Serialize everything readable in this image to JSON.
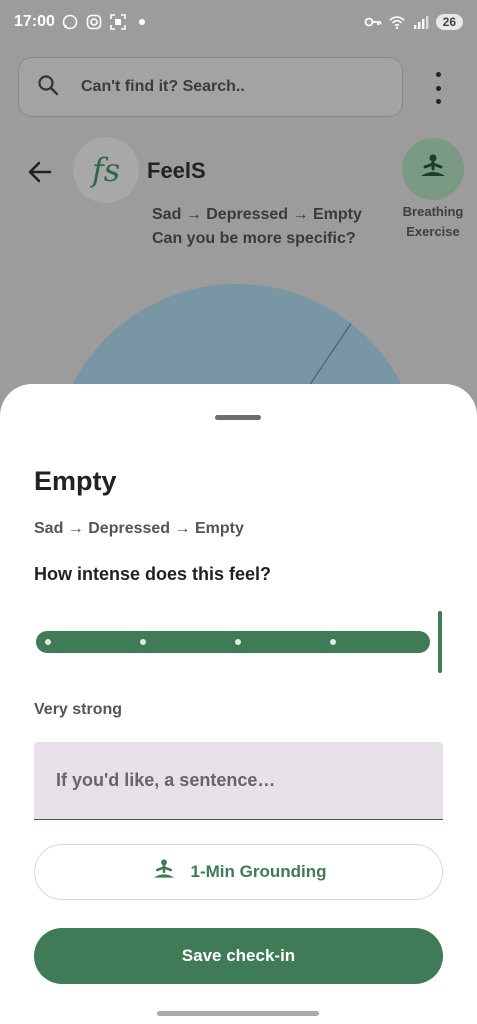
{
  "status_bar": {
    "time": "17:00",
    "battery": "26"
  },
  "search": {
    "placeholder": "Can't find it? Search.."
  },
  "header": {
    "logo_text": "fs",
    "app_title": "FeelS",
    "path": "Sad → Depressed → Empty",
    "prompt": "Can you be more specific?",
    "breathing_label_line1": "Breathing",
    "breathing_label_line2": "Exercise"
  },
  "sheet": {
    "title": "Empty",
    "path": "Sad → Depressed → Empty",
    "question": "How intense does this feel?",
    "intensity": {
      "value": 5,
      "min": 1,
      "max": 5,
      "label": "Very strong"
    },
    "note_placeholder": "If you'd like, a sentence…",
    "grounding_label": "1-Min Grounding",
    "save_label": "Save check-in"
  },
  "colors": {
    "accent": "#3f7b56",
    "wheel": "#7896a3",
    "field_bg": "#e7e0e8"
  },
  "icons": {
    "search": "search-icon",
    "back": "back-arrow-icon",
    "menu": "more-vert-icon",
    "breathing": "meditation-icon",
    "grounding": "meditation-icon"
  }
}
